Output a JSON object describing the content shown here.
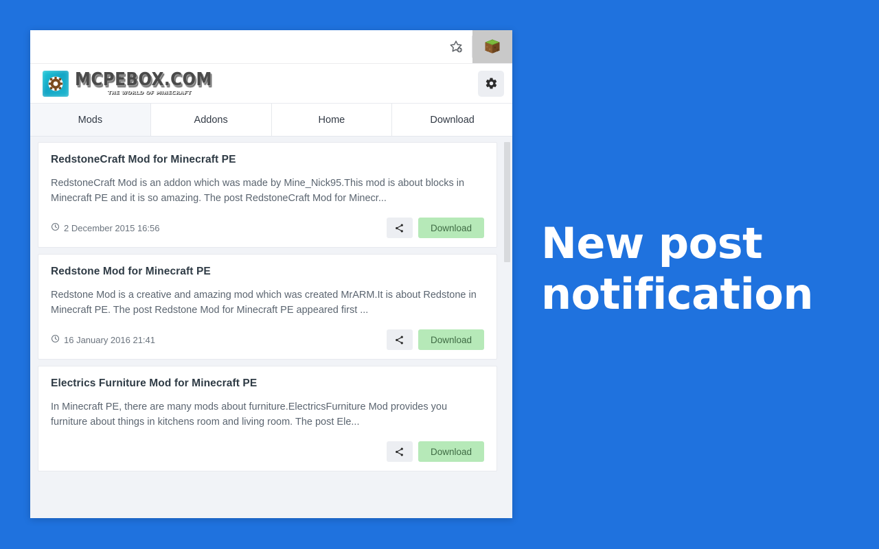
{
  "background_color": "#1f72de",
  "browser_toolbar": {
    "bookmark_icon": "star-add-icon",
    "extension_icon": "minecraft-grass-block-icon"
  },
  "site_header": {
    "brand_title": "MCPEBOX.COM",
    "brand_subtitle": "THE WORLD OF MINECRAFT",
    "brand_mark_icon": "gear-logo-icon",
    "settings_icon": "gear-icon"
  },
  "tabs": [
    {
      "label": "Mods",
      "active": true
    },
    {
      "label": "Addons",
      "active": false
    },
    {
      "label": "Home",
      "active": false
    },
    {
      "label": "Download",
      "active": false
    }
  ],
  "posts": [
    {
      "title": "RedstoneCraft Mod for Minecraft PE",
      "excerpt": "RedstoneCraft Mod is an addon which was made by Mine_Nick95.This mod is about blocks in Minecraft PE and it is so amazing. The post RedstoneCraft Mod for Minecr...",
      "date": "2 December 2015 16:56",
      "clock_icon": "clock-icon",
      "share_icon": "share-icon",
      "download_label": "Download"
    },
    {
      "title": "Redstone Mod for Minecraft PE",
      "excerpt": "Redstone Mod is a creative and amazing mod which was created MrARM.It is about Redstone in Minecraft PE. The post Redstone Mod for Minecraft PE appeared first ...",
      "date": "16 January 2016 21:41",
      "clock_icon": "clock-icon",
      "share_icon": "share-icon",
      "download_label": "Download"
    },
    {
      "title": "Electrics Furniture Mod for Minecraft PE",
      "excerpt": "In Minecraft PE, there are many mods about furniture.ElectricsFurniture Mod provides you furniture about things in kitchens room and living room. The post Ele...",
      "date": "",
      "clock_icon": "clock-icon",
      "share_icon": "share-icon",
      "download_label": "Download"
    }
  ],
  "caption": {
    "line1": "New post",
    "line2": "notification",
    "color": "#ffffff"
  },
  "colors": {
    "accent_blue": "#1f72de",
    "download_button_bg": "#b6e9b8",
    "download_button_text": "#3f6b44",
    "card_bg": "#ffffff",
    "feed_bg": "#f1f3f7"
  }
}
